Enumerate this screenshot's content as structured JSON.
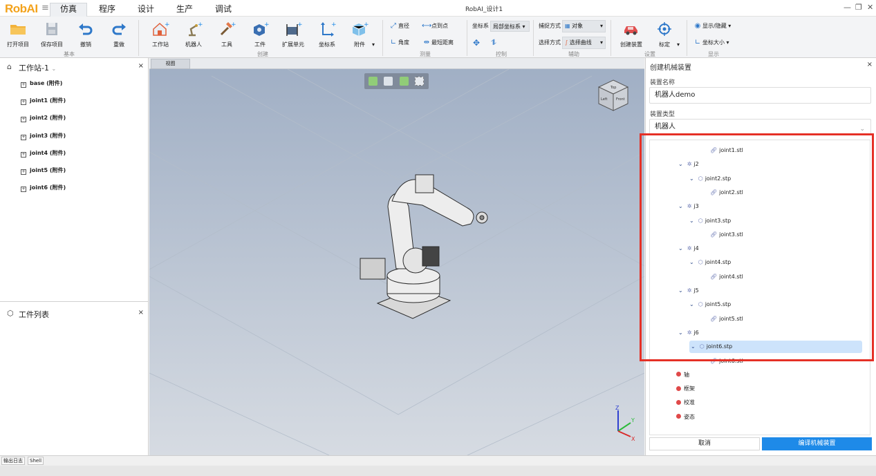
{
  "app": {
    "logo": "RobAI",
    "window_title": "RobAI_设计1",
    "menu_tabs": [
      "仿真",
      "程序",
      "设计",
      "生产",
      "调试"
    ],
    "active_tab": "仿真",
    "win_controls": [
      "—",
      "❐",
      "✕"
    ]
  },
  "ribbon": {
    "basic": {
      "group": "基本",
      "open": "打开项目",
      "save": "保存项目",
      "undo": "撤销",
      "redo": "重做"
    },
    "create": {
      "group": "创建",
      "workstation": "工作站",
      "robot": "机器人",
      "tool": "工具",
      "workpiece": "工件",
      "extension": "扩展单元",
      "coordsys": "坐标系",
      "attachment": "附件"
    },
    "measure": {
      "group": "测量",
      "diameter": "直径",
      "point_to_point": "点到点",
      "angle": "角度",
      "shortest": "最短距离"
    },
    "control": {
      "group": "控制",
      "coord_label": "坐标系",
      "coord_value": "局部坐标系"
    },
    "assist": {
      "group": "辅助",
      "capture_label": "捕捉方式",
      "capture_value": "对象",
      "select_label": "选择方式",
      "select_value": "选择曲线"
    },
    "settings": {
      "group": "设置",
      "create_device": "创建装置",
      "calibrate": "标定"
    },
    "display": {
      "group": "显示",
      "show_hide": "显示/隐藏",
      "axis_size": "坐标大小"
    }
  },
  "left_panel": {
    "workstation_title": "工作站-1",
    "items": [
      "base (附件)",
      "joint1 (附件)",
      "joint2 (附件)",
      "joint3 (附件)",
      "joint4 (附件)",
      "joint5 (附件)",
      "joint6 (附件)"
    ],
    "workpiece_title": "工件列表"
  },
  "viewport": {
    "tab": "视图",
    "cube_faces": [
      "Top",
      "Left",
      "Front"
    ],
    "axes": [
      "Z",
      "Y",
      "X"
    ]
  },
  "right_panel": {
    "title": "创建机械装置",
    "name_label": "装置名称",
    "name_value": "机器人demo",
    "type_label": "装置类型",
    "type_value": "机器人",
    "tree": [
      {
        "level": 3,
        "kind": "file",
        "label": "joint1.stl"
      },
      {
        "level": 1,
        "kind": "joint",
        "label": "j2"
      },
      {
        "level": 2,
        "kind": "part",
        "label": "joint2.stp"
      },
      {
        "level": 3,
        "kind": "file",
        "label": "joint2.stl"
      },
      {
        "level": 1,
        "kind": "joint",
        "label": "j3"
      },
      {
        "level": 2,
        "kind": "part",
        "label": "joint3.stp"
      },
      {
        "level": 3,
        "kind": "file",
        "label": "joint3.stl"
      },
      {
        "level": 1,
        "kind": "joint",
        "label": "j4"
      },
      {
        "level": 2,
        "kind": "part",
        "label": "joint4.stp"
      },
      {
        "level": 3,
        "kind": "file",
        "label": "joint4.stl"
      },
      {
        "level": 1,
        "kind": "joint",
        "label": "j5"
      },
      {
        "level": 2,
        "kind": "part",
        "label": "joint5.stp"
      },
      {
        "level": 3,
        "kind": "file",
        "label": "joint5.stl"
      },
      {
        "level": 1,
        "kind": "joint",
        "label": "j6"
      },
      {
        "level": 2,
        "kind": "part",
        "label": "joint6.stp",
        "selected": true
      },
      {
        "level": 3,
        "kind": "file",
        "label": "joint6.stl"
      },
      {
        "level": 0,
        "kind": "dot",
        "label": "轴"
      },
      {
        "level": 0,
        "kind": "dot",
        "label": "框架"
      },
      {
        "level": 0,
        "kind": "dot",
        "label": "校准"
      },
      {
        "level": 0,
        "kind": "dot",
        "label": "姿态"
      }
    ],
    "cancel": "取消",
    "compile": "编译机械装置"
  },
  "bottom_tabs": [
    "输出日志",
    "Shell"
  ],
  "colors": {
    "accent": "#1e8ae8",
    "logo": "#f3a21b",
    "highlight": "#e53026",
    "node_dot": "#e04949"
  }
}
